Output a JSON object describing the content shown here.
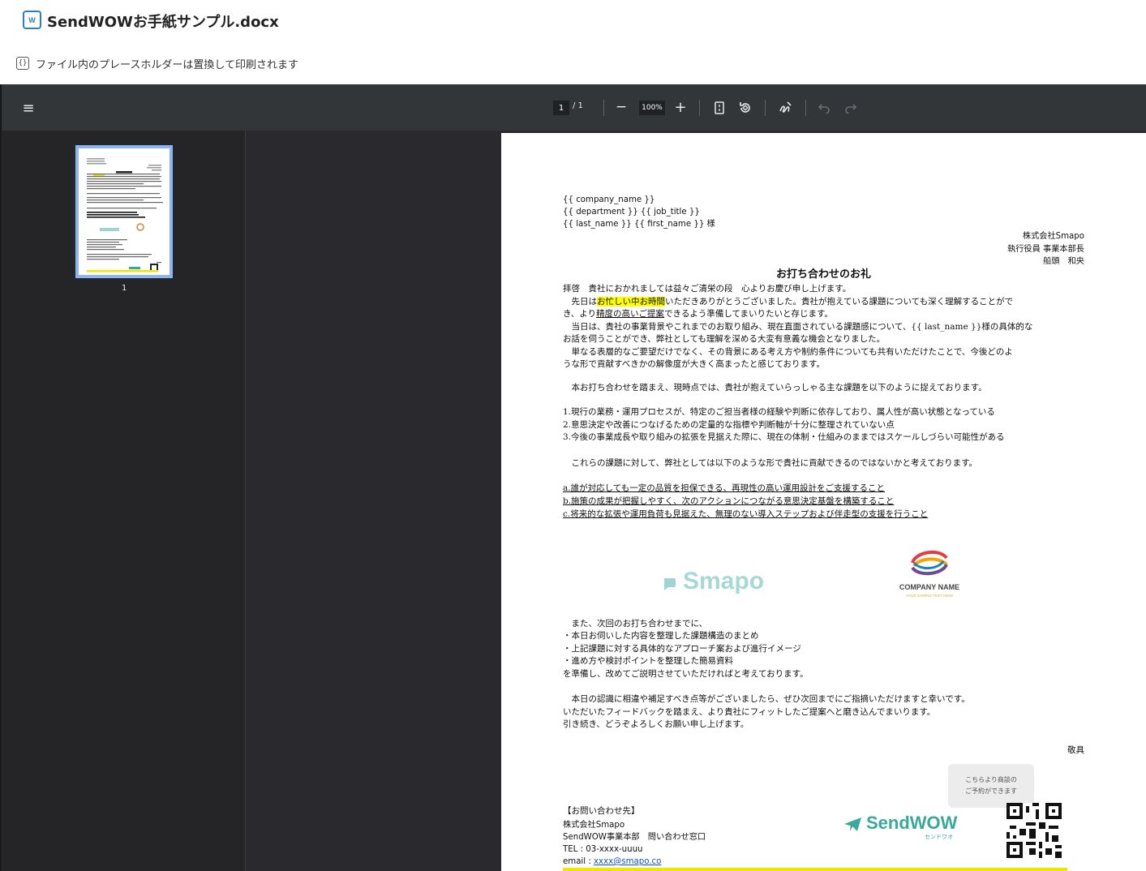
{
  "header": {
    "file_icon": "W",
    "title": "SendWOWお手紙サンプル.docx",
    "notice_icon": "{}",
    "notice": "ファイル内のプレースホルダーは置換して印刷されます"
  },
  "toolbar": {
    "menu_icon": "≡",
    "page_current": "1",
    "page_total": "/ 1",
    "zoom_out": "−",
    "zoom": "100%",
    "zoom_in": "+",
    "fit_icon": "fit-page-icon",
    "rotate_icon": "rotate-icon",
    "draw_icon": "annotate-icon",
    "undo_icon": "undo-icon",
    "redo_icon": "redo-icon"
  },
  "sidebar": {
    "thumb_label": "1"
  },
  "doc": {
    "addr1": "{{ company_name }}",
    "addr2": "{{ department }} {{ job_title }}",
    "addr3": "{{ last_name }} {{ first_name }} 様",
    "sender1": "株式会社Smapo",
    "sender2": "執行役員 事業本部長",
    "sender3": "船頭　和央",
    "heading": "お打ち合わせのお礼",
    "p1": "拝啓　貴社におかれましては益々ご清栄の段　心よりお慶び申し上げます。",
    "p2a": "　先日は",
    "p2_hl": "お忙しい中お時間",
    "p2b": "いただきありがとうございました。貴社が抱えている課題についても深く理解することがで",
    "p3a": "き、より",
    "p3_ul": "精度の高いご提案",
    "p3b": "できるよう準備してまいりたいと存じます。",
    "p4": "　当日は、貴社の事業背景やこれまでのお取り組み、現在直面されている課題感について、{{ last_name }}様の具体的な",
    "p5": "お話を伺うことができ、弊社としても理解を深める大変有意義な機会となりました。",
    "p6": "　単なる表層的なご要望だけでなく、その背景にある考え方や制約条件についても共有いただけたことで、今後どのよ",
    "p7": "うな形で貢献すべきかの解像度が大きく高まったと感じております。",
    "p8": "　本お打ち合わせを踏まえ、現時点では、貴社が抱えていらっしゃる主な課題を以下のように捉えております。",
    "issue1": "1.現行の業務・運用プロセスが、特定のご担当者様の経験や判断に依存しており、属人性が高い状態となっている",
    "issue2": "2.意思決定や改善につなげるための定量的な指標や判断軸が十分に整理されていない点",
    "issue3": "3.今後の事業成長や取り組みの拡張を見据えた際に、現在の体制・仕組みのままではスケールしづらい可能性がある",
    "p9": "　これらの課題に対して、弊社としては以下のような形で貴社に貢献できるのではないかと考えております。",
    "prop_a": "a.誰が対応しても一定の品質を担保できる、再現性の高い運用設計をご支援すること",
    "prop_b": "b.施策の成果が把握しやすく、次のアクションにつながる意思決定基盤を構築すること",
    "prop_c": "c.将来的な拡張や運用負荷も見据えた、無理のない導入ステップおよび伴走型の支援を行うこと",
    "logo_smapo": "Smapo",
    "logo_company": "COMPANY NAME",
    "logo_company_tag": "YOUR SAMPLE TEXT HERE",
    "n1": "　また、次回のお打ち合わせまでに、",
    "n2": "・本日お伺いした内容を整理した課題構造のまとめ",
    "n3": "・上記課題に対する具体的なアプローチ案および進行イメージ",
    "n4": "・進め方や検討ポイントを整理した簡易資料",
    "n5": "を準備し、改めてご説明させていただければと考えております。",
    "c1": "　本日の認識に相違や補足すべき点等がございましたら、ぜひ次回までにご指摘いただけますと幸いです。",
    "c2": "いただいたフィードバックを踏まえ、より貴社にフィットしたご提案へと磨き込んでまいります。",
    "c3": "引き続き、どうぞよろしくお願い申し上げます。",
    "closing": "敬具",
    "qr_bubble1": "こちらより商談の",
    "qr_bubble2": "ご予約ができます",
    "contact_title": "【お問い合わせ先】",
    "contact_co": "株式会社Smapo",
    "contact_dept": "SendWOW事業本部　問い合わせ窓口",
    "contact_tel": "TEL : 03-xxxx-uuuu",
    "contact_email_label": "email : ",
    "contact_email": "xxxx@smapo.co",
    "sendwow_logo": "SendWOW",
    "sendwow_kana": "センドワオ"
  }
}
